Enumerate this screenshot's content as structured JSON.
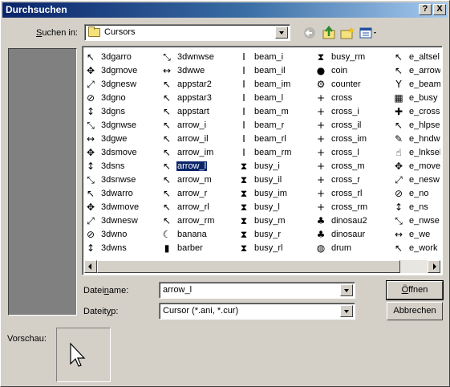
{
  "dialog": {
    "title": "Durchsuchen",
    "help_label": "?",
    "close_label": "X"
  },
  "lookin": {
    "label_prefix": "S",
    "label_rest": "uchen in:",
    "value": "Cursors"
  },
  "toolbar": {
    "back_icon": "back-arrow-icon",
    "up_icon": "up-folder-icon",
    "new_folder_icon": "new-folder-icon",
    "view_icon": "view-menu-icon"
  },
  "files": {
    "columns": [
      [
        {
          "name": "3dgarro",
          "icon": "↖"
        },
        {
          "name": "3dgmove",
          "icon": "✥"
        },
        {
          "name": "3dgnesw",
          "icon": "⤢"
        },
        {
          "name": "3dgno",
          "icon": "⊘"
        },
        {
          "name": "3dgns",
          "icon": "↕"
        },
        {
          "name": "3dgnwse",
          "icon": "⤡"
        },
        {
          "name": "3dgwe",
          "icon": "↔"
        },
        {
          "name": "3dsmove",
          "icon": "✥"
        },
        {
          "name": "3dsns",
          "icon": "↕"
        },
        {
          "name": "3dsnwse",
          "icon": "⤡"
        },
        {
          "name": "3dwarro",
          "icon": "↖"
        },
        {
          "name": "3dwmove",
          "icon": "✥"
        },
        {
          "name": "3dwnesw",
          "icon": "⤢"
        },
        {
          "name": "3dwno",
          "icon": "⊘"
        },
        {
          "name": "3dwns",
          "icon": "↕"
        }
      ],
      [
        {
          "name": "3dwnwse",
          "icon": "⤡"
        },
        {
          "name": "3dwwe",
          "icon": "↔"
        },
        {
          "name": "appstar2",
          "icon": "↖"
        },
        {
          "name": "appstar3",
          "icon": "↖"
        },
        {
          "name": "appstart",
          "icon": "↖"
        },
        {
          "name": "arrow_i",
          "icon": "↖"
        },
        {
          "name": "arrow_il",
          "icon": "↖"
        },
        {
          "name": "arrow_im",
          "icon": "↖"
        },
        {
          "name": "arrow_l",
          "icon": "↖",
          "selected": true
        },
        {
          "name": "arrow_m",
          "icon": "↖"
        },
        {
          "name": "arrow_r",
          "icon": "↖"
        },
        {
          "name": "arrow_rl",
          "icon": "↖"
        },
        {
          "name": "arrow_rm",
          "icon": "↖"
        },
        {
          "name": "banana",
          "icon": "☾"
        },
        {
          "name": "barber",
          "icon": "▮"
        }
      ],
      [
        {
          "name": "beam_i",
          "icon": "I"
        },
        {
          "name": "beam_il",
          "icon": "I"
        },
        {
          "name": "beam_im",
          "icon": "I"
        },
        {
          "name": "beam_l",
          "icon": "I"
        },
        {
          "name": "beam_m",
          "icon": "I"
        },
        {
          "name": "beam_r",
          "icon": "I"
        },
        {
          "name": "beam_rl",
          "icon": "I"
        },
        {
          "name": "beam_rm",
          "icon": "I"
        },
        {
          "name": "busy_i",
          "icon": "⧗"
        },
        {
          "name": "busy_il",
          "icon": "⧗"
        },
        {
          "name": "busy_im",
          "icon": "⧗"
        },
        {
          "name": "busy_l",
          "icon": "⧗"
        },
        {
          "name": "busy_m",
          "icon": "⧗"
        },
        {
          "name": "busy_r",
          "icon": "⧗"
        },
        {
          "name": "busy_rl",
          "icon": "⧗"
        }
      ],
      [
        {
          "name": "busy_rm",
          "icon": "⧗"
        },
        {
          "name": "coin",
          "icon": "●"
        },
        {
          "name": "counter",
          "icon": "⚙"
        },
        {
          "name": "cross",
          "icon": "+"
        },
        {
          "name": "cross_i",
          "icon": "+"
        },
        {
          "name": "cross_il",
          "icon": "+"
        },
        {
          "name": "cross_im",
          "icon": "+"
        },
        {
          "name": "cross_l",
          "icon": "+"
        },
        {
          "name": "cross_m",
          "icon": "+"
        },
        {
          "name": "cross_r",
          "icon": "+"
        },
        {
          "name": "cross_rl",
          "icon": "+"
        },
        {
          "name": "cross_rm",
          "icon": "+"
        },
        {
          "name": "dinosau2",
          "icon": "♣"
        },
        {
          "name": "dinosaur",
          "icon": "♣"
        },
        {
          "name": "drum",
          "icon": "◍"
        }
      ],
      [
        {
          "name": "e_altsel",
          "icon": "↖"
        },
        {
          "name": "e_arrow",
          "icon": "↖"
        },
        {
          "name": "e_beam",
          "icon": "Y"
        },
        {
          "name": "e_busy",
          "icon": "▦"
        },
        {
          "name": "e_cross",
          "icon": "✚"
        },
        {
          "name": "e_hlpsel",
          "icon": "↖"
        },
        {
          "name": "e_hndwrt",
          "icon": "✎"
        },
        {
          "name": "e_lnksel",
          "icon": "☝"
        },
        {
          "name": "e_move",
          "icon": "✥"
        },
        {
          "name": "e_nesw",
          "icon": "⤢"
        },
        {
          "name": "e_no",
          "icon": "⊘"
        },
        {
          "name": "e_ns",
          "icon": "↕"
        },
        {
          "name": "e_nwse",
          "icon": "⤡"
        },
        {
          "name": "e_we",
          "icon": "↔"
        },
        {
          "name": "e_work",
          "icon": "↖"
        }
      ]
    ]
  },
  "filename": {
    "label_pre": "Datei",
    "label_u": "n",
    "label_post": "ame:",
    "value": "arrow_l"
  },
  "filetype": {
    "label_pre": "Dateit",
    "label_u": "y",
    "label_post": "p:",
    "value": "Cursor (*.ani, *.cur)"
  },
  "buttons": {
    "open_u": "Ö",
    "open_rest": "ffnen",
    "cancel": "Abbrechen"
  },
  "preview": {
    "label": "Vorschau:"
  },
  "colors": {
    "title_start": "#0a246a",
    "title_end": "#a6caf0",
    "face": "#d4d0c8",
    "selection": "#0a246a"
  }
}
